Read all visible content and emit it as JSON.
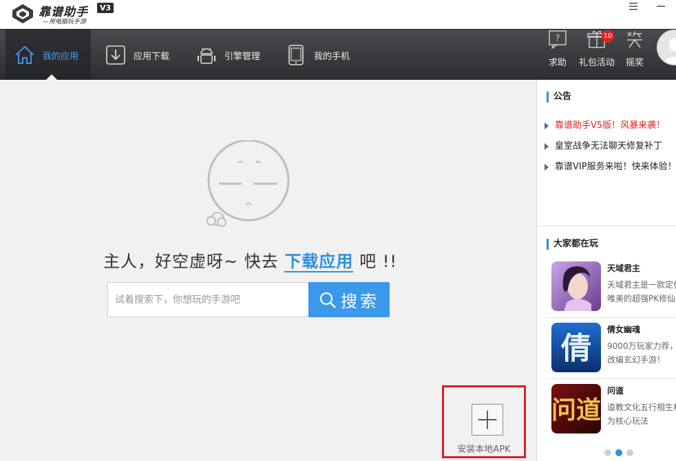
{
  "app": {
    "name": "靠谱助手",
    "tagline": "—用电脑玩手游",
    "version": "V3",
    "window_menu_glyph": "☰",
    "window_min_glyph": "—"
  },
  "nav": {
    "tabs": [
      {
        "label": "我的应用",
        "icon": "home-icon",
        "active": true
      },
      {
        "label": "应用下载",
        "icon": "download-icon",
        "active": false
      },
      {
        "label": "引擎管理",
        "icon": "android-icon",
        "active": false
      },
      {
        "label": "我的手机",
        "icon": "phone-icon",
        "active": false
      }
    ],
    "tools": [
      {
        "label": "求助",
        "icon": "help-icon"
      },
      {
        "label": "礼包活动",
        "icon": "gift-icon",
        "badge": "10"
      },
      {
        "label": "摇奖",
        "icon": "reward-icon"
      }
    ]
  },
  "main": {
    "empty_message_prefix": "主人，好空虚呀~ 快去 ",
    "empty_message_link": "下载应用",
    "empty_message_suffix": " 吧 !!",
    "search": {
      "placeholder": "试着搜索下，你想玩的手游吧",
      "value": "",
      "button_label": "搜索"
    },
    "install_apk_label": "安装本地APK"
  },
  "sidebar": {
    "notice_title": "公告",
    "notices": [
      {
        "text": "靠谱助手V5版！风暴来袭！",
        "hot": true
      },
      {
        "text": "皇室战争无法聊天修复补丁",
        "hot": false
      },
      {
        "text": "靠谱VIP服务来啦！快来体验！",
        "hot": false
      }
    ],
    "popular_title": "大家都在玩",
    "games": [
      {
        "name": "天域君主",
        "desc_lines": [
          "天域君主是一款定位",
          "唯美的超强PK修仙"
        ],
        "icon": "tianyu-game-icon"
      },
      {
        "name": "倩女幽魂",
        "desc_lines": [
          "9000万玩家力荐，",
          "改编玄幻手游！"
        ],
        "icon": "qiannv-game-icon"
      },
      {
        "name": "问道",
        "desc_lines": [
          "道教文化五行相生相",
          "为核心玩法"
        ],
        "icon": "wendao-game-icon"
      }
    ],
    "pager": {
      "pages": 3,
      "current": 2
    }
  },
  "colors": {
    "accent": "#2d8fe0",
    "hot": "#e02020",
    "nav_bg": "#3a3b3f",
    "content_bg": "#f1f1f1",
    "highlight_frame": "#dd1f1f"
  }
}
